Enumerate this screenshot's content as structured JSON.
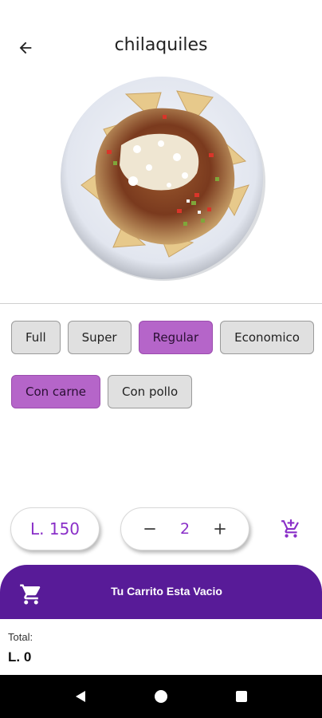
{
  "header": {
    "title": "chilaquiles",
    "back_icon": "arrow-back-icon"
  },
  "product": {
    "image": "chilaquiles-plate-image"
  },
  "sizes": [
    {
      "label": "Full",
      "selected": false
    },
    {
      "label": "Super",
      "selected": false
    },
    {
      "label": "Regular",
      "selected": true
    },
    {
      "label": "Economico",
      "selected": false
    }
  ],
  "fillings": [
    {
      "label": "Con carne",
      "selected": true
    },
    {
      "label": "Con pollo",
      "selected": false
    }
  ],
  "price": {
    "text": "L. 150"
  },
  "quantity": {
    "value": "2",
    "minus_icon": "minus-icon",
    "plus_icon": "plus-icon"
  },
  "add_to_cart_icon": "add-shopping-cart-icon",
  "cart": {
    "label": "Tu Carrito Esta Vacio",
    "icon": "shopping-cart-icon"
  },
  "total": {
    "label": "Total:",
    "value": "L. 0"
  },
  "colors": {
    "accent": "#8a2fc8",
    "chip_selected": "#b565c9",
    "cart_bar": "#581b98"
  }
}
